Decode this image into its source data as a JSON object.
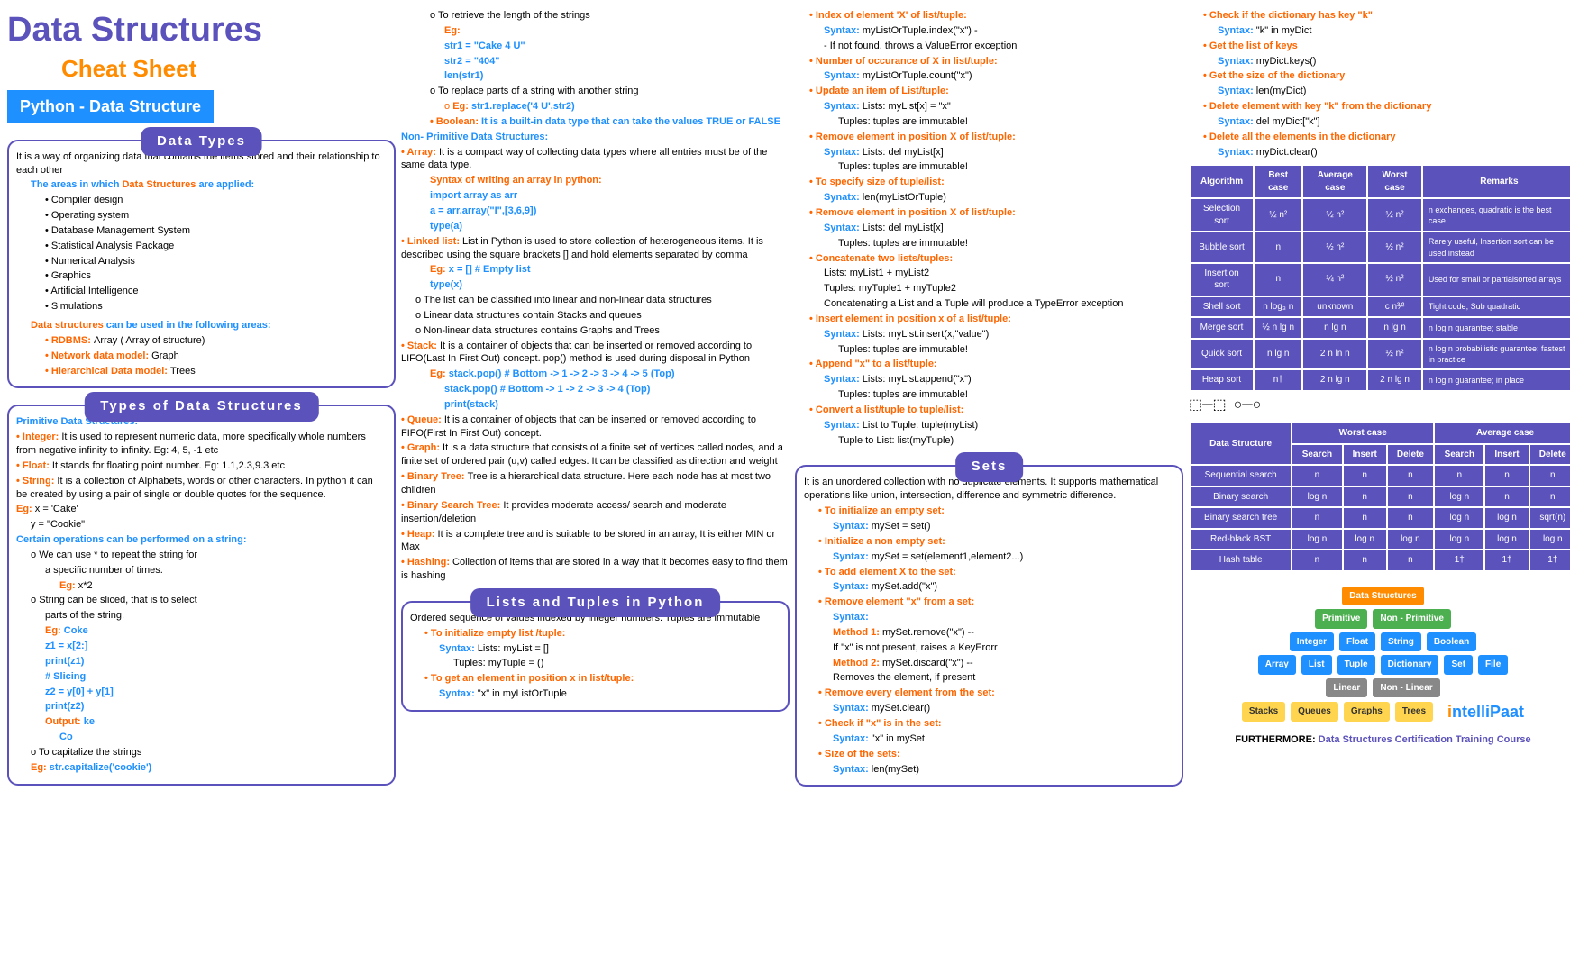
{
  "header": {
    "main_title": "Data Structures",
    "sub_title": "Cheat Sheet",
    "badge": "Python - Data Structure"
  },
  "c1": {
    "dt_title": "Data Types",
    "dt_intro": "It is a way of organizing data that contains the items stored and their relationship to each other",
    "dt_areas_lead": "The areas in which ",
    "dt_areas_bold": "Data Structures",
    "dt_areas_tail": " are applied:",
    "dt_app1": "Compiler design",
    "dt_app2": "Operating system",
    "dt_app3": "Database Management System",
    "dt_app4": "Statistical Analysis Package",
    "dt_app5": "Numerical Analysis",
    "dt_app6": "Graphics",
    "dt_app7": "Artificial Intelligence",
    "dt_app8": "Simulations",
    "dt_used_lead": "Data structures",
    "dt_used_tail": " can be used in the following areas:",
    "dt_m1a": "RDBMS: ",
    "dt_m1b": "Array ( Array of structure)",
    "dt_m2a": "Network data model: ",
    "dt_m2b": "Graph",
    "dt_m3a": "Hierarchical Data model: ",
    "dt_m3b": "Trees",
    "tds_title": "Types of Data Structures",
    "tds_prim_head": "Primitive Data Structures:",
    "tds_int_a": "Integer: ",
    "tds_int_b": "It is used to represent numeric data, more specifically whole numbers from negative infinity to infinity. Eg: 4, 5, -1 etc",
    "tds_flt_a": "Float: ",
    "tds_flt_b": "It stands for floating point number. Eg: 1.1,2.3,9.3 etc",
    "tds_str_a": "String: ",
    "tds_str_b": "It is a collection of Alphabets, words or other characters. In python it can be created by using a pair of single or double quotes for the sequence.",
    "tds_eg1a": "Eg: ",
    "tds_eg1b": "x = 'Cake'",
    "tds_eg2": "y = \"Cookie\"",
    "tds_ops_head": "Certain operations can be performed on a string:",
    "tds_op1a": "We can use * to repeat the string for",
    "tds_op1b": "a specific number of times.",
    "tds_op1_eg_a": "Eg: ",
    "tds_op1_eg_b": "x*2",
    "tds_op2a": "String can be sliced, that is to select",
    "tds_op2b": "parts of the string.",
    "tds_op2_eg": "Eg:",
    "tds_op2_coke": "Coke",
    "tds_op2_l1": "z1 = x[2:]",
    "tds_op2_l2": "print(z1)",
    "tds_op2_l3": "# Slicing",
    "tds_op2_l4": "z2 = y[0] + y[1]",
    "tds_op2_l5": "print(z2)",
    "tds_op2_out_a": "Output: ",
    "tds_op2_out_b": "ke",
    "tds_op2_out_c": "Co",
    "tds_cap_a": "To capitalize the strings",
    "tds_cap_eg_a": "Eg: ",
    "tds_cap_eg_b": "str.capitalize('cookie')"
  },
  "c2": {
    "len_a": "To retrieve the length of the strings",
    "len_eg": "Eg:",
    "len_l1": "str1 = \"Cake 4 U\"",
    "len_l2": "str2 = \"404\"",
    "len_l3": "len(str1)",
    "rep_a": "To replace parts of a string with another string",
    "rep_eg_a": "Eg: ",
    "rep_eg_b": "str1.replace('4 U',str2)",
    "bool_a": "Boolean: ",
    "bool_b": "It is a built-in data type that can take the values TRUE or FALSE",
    "np_head": "Non- Primitive Data Structures:",
    "arr_a": "Array: ",
    "arr_b": "It is a compact way of collecting data types where all entries must be of the same data type.",
    "arr_syn_head": "Syntax of writing an array in python:",
    "arr_l1": "import array as arr",
    "arr_l2": "a = arr.array(\"I\",[3,6,9])",
    "arr_l3": "type(a)",
    "ll_a": "Linked list: ",
    "ll_b": "List in Python is used to store collection of heterogeneous items. It is described using the square brackets [] and hold elements separated by comma",
    "ll_eg_a": "Eg: ",
    "ll_eg_b": "x = [] # Empty list",
    "ll_eg_c": "type(x)",
    "ll_c1": "The list can be classified into linear and non-linear data structures",
    "ll_c2": "Linear data structures contain Stacks and queues",
    "ll_c3": "Non-linear data structures contains Graphs and Trees",
    "stk_a": "Stack: ",
    "stk_b": "It is a container of objects that can be inserted or removed according to LIFO(Last In First Out) concept. pop() method is used during disposal in Python",
    "stk_eg_a": "Eg: ",
    "stk_eg_b": "stack.pop() # Bottom -> 1 -> 2 -> 3 -> 4 -> 5 (Top)",
    "stk_eg_c": "stack.pop() # Bottom -> 1 -> 2 -> 3 -> 4 (Top)",
    "stk_eg_d": "print(stack)",
    "que_a": "Queue: ",
    "que_b": "It is a container of objects that can be inserted or removed according to FIFO(First In First Out) concept.",
    "grp_a": "Graph: ",
    "grp_b": "It is a data structure that consists of a finite set of vertices called nodes, and a finite set of ordered pair (u,v) called edges. It can be classified as direction and weight",
    "bt_a": "Binary Tree: ",
    "bt_b": "Tree is a hierarchical data structure. Here each node has at most two children",
    "bst_a": "Binary Search Tree: ",
    "bst_b": "It provides moderate access/ search and moderate insertion/deletion",
    "hp_a": "Heap: ",
    "hp_b": "It is a complete tree and is suitable to be stored in an array, It is either MIN or Max",
    "hsh_a": "Hashing: ",
    "hsh_b": "Collection of items that are stored in a way that it becomes easy to find them is hashing",
    "lt_title": "Lists and Tuples in Python",
    "lt_intro": "Ordered sequence of values indexed by integer numbers. Tuples are immutable",
    "lt_init_head": "To initialize empty list /tuple:",
    "lt_init_l": "Syntax: ",
    "lt_init_lb": "Lists: myList = []",
    "lt_init_t": "Tuples: myTuple = ()",
    "lt_get_head": "To get an element in position x in list/tuple:",
    "lt_get_a": "Syntax: ",
    "lt_get_b": "\"x\" in myListOrTuple"
  },
  "c3": {
    "idx_head": "Index of element 'X' of list/tuple:",
    "idx_a": "Syntax: ",
    "idx_b": "myListOrTuple.index(\"x\") -",
    "idx_c": "- If not found, throws a ValueError exception",
    "cnt_head": "Number of occurance of X in list/tuple:",
    "cnt_a": "Syntax: ",
    "cnt_b": "myListOrTuple.count(\"x\")",
    "upd_head": "Update an item of List/tuple:",
    "upd_a": "Syntax: ",
    "upd_b": "Lists: myList[x] = \"x\"",
    "upd_c": "Tuples: tuples are immutable!",
    "rem_head": "Remove element in position X of list/tuple:",
    "rem_a": "Syntax: ",
    "rem_b": "Lists: del myList[x]",
    "rem_c": "Tuples: tuples are immutable!",
    "size_head": "To specify size of tuple/list:",
    "size_a": "Synatx: ",
    "size_b": "len(myListOrTuple)",
    "rem2_head": "Remove element in position X of list/tuple:",
    "rem2_a": "Syntax: ",
    "rem2_b": "Lists: del myList[x]",
    "rem2_c": "Tuples: tuples are immutable!",
    "cat_head": "Concatenate two lists/tuples:",
    "cat_l": "Lists: myList1 + myList2",
    "cat_t": "Tuples: myTuple1 + myTuple2",
    "cat_warn": "Concatenating a List and a Tuple will produce a TypeError exception",
    "ins_head": "Insert element in position x of a list/tuple:",
    "ins_a": "Syntax: ",
    "ins_b": "Lists: myList.insert(x,\"value\")",
    "ins_c": "Tuples: tuples are immutable!",
    "app_head": "Append \"x\" to a list/tuple:",
    "app_a": "Syntax: ",
    "app_b": "Lists: myList.append(\"x\")",
    "app_c": "Tuples: tuples are immutable!",
    "cvt_head": "Convert a list/tuple to tuple/list:",
    "cvt_a": "Syntax: ",
    "cvt_b": "List to Tuple: tuple(myList)",
    "cvt_c": "Tuple to List: list(myTuple)",
    "sets_title": "Sets",
    "sets_intro": "It is an unordered collection with no duplicate elements. It supports mathematical operations like union, intersection, difference and symmetric difference.",
    "s_init_head": "To initialize an empty set:",
    "s_init_a": "Syntax: ",
    "s_init_b": "mySet = set()",
    "s_ne_head": "Initialize a non empty set:",
    "s_ne_a": "Syntax: ",
    "s_ne_b": "mySet = set(element1,element2...)",
    "s_add_head": "To add element X to the set:",
    "s_add_a": "Syntax: ",
    "s_add_b": "mySet.add(\"x\")",
    "s_rem_head": "Remove element \"x\" from a set:",
    "s_rem_a": "Syntax:",
    "s_rem_m1a": "Method 1: ",
    "s_rem_m1b": "mySet.remove(\"x\") --",
    "s_rem_m1c": "If \"x\" is not present, raises a KeyErorr",
    "s_rem_m2a": "Method 2: ",
    "s_rem_m2b": "mySet.discard(\"x\") --",
    "s_rem_m2c": "Removes the element, if present",
    "s_clr_head": "Remove every element from the set:",
    "s_clr_a": "Syntax: ",
    "s_clr_b": "mySet.clear()",
    "s_in_head": "Check if \"x\" is in the set:",
    "s_in_a": "Syntax: ",
    "s_in_b": "\"x\" in mySet",
    "s_sz_head": "Size of the sets:",
    "s_sz_a": "Syntax: ",
    "s_sz_b": "len(mySet)"
  },
  "c4": {
    "d1": "Check if the dictionary has key \"k\"",
    "d1a": "Syntax: ",
    "d1b": "\"k\" in myDict",
    "d2": "Get the list of keys",
    "d2a": "Syntax: ",
    "d2b": "myDict.keys()",
    "d3": "Get the size of the dictionary",
    "d3a": "Syntax: ",
    "d3b": "len(myDict)",
    "d4": "Delete element with key \"k\" from the dictionary",
    "d4a": "Syntax: ",
    "d4b": "del myDict[\"k\"]",
    "d5": "Delete all the elements in the dictionary",
    "d5a": "Syntax: ",
    "d5b": "myDict.clear()",
    "tbl1_head": [
      "Algorithm",
      "Best case",
      "Average case",
      "Worst case",
      "Remarks"
    ],
    "tbl1": [
      [
        "Selection sort",
        "½ n²",
        "½ n²",
        "½ n²",
        "n exchanges, quadratic is the best case"
      ],
      [
        "Bubble sort",
        "n",
        "½ n²",
        "½ n²",
        "Rarely useful, Insertion sort can be used instead"
      ],
      [
        "Insertion sort",
        "n",
        "¼ n²",
        "½ n²",
        "Used for small or partialsorted arrays"
      ],
      [
        "Shell sort",
        "n log₃ n",
        "unknown",
        "c n³⁄²",
        "Tight code, Sub quadratic"
      ],
      [
        "Merge sort",
        "½ n lg n",
        "n lg n",
        "n lg n",
        "n log n guarantee; stable"
      ],
      [
        "Quick sort",
        "n lg n",
        "2 n ln n",
        "½ n²",
        "n log n probabilistic guarantee; fastest in practice"
      ],
      [
        "Heap sort",
        "n†",
        "2 n lg n",
        "2 n lg n",
        "n log n guarantee; in place"
      ]
    ],
    "tbl2_head": [
      "Data Structure",
      "Search",
      "Insert",
      "Delete",
      "Search",
      "Insert",
      "Delete"
    ],
    "tbl2_span_head": [
      "Worst case",
      "Average case"
    ],
    "tbl2": [
      [
        "Sequential search",
        "n",
        "n",
        "n",
        "n",
        "n",
        "n"
      ],
      [
        "Binary search",
        "log n",
        "n",
        "n",
        "log n",
        "n",
        "n"
      ],
      [
        "Binary search tree",
        "n",
        "n",
        "n",
        "log n",
        "log n",
        "sqrt(n)"
      ],
      [
        "Red-black BST",
        "log n",
        "log n",
        "log n",
        "log n",
        "log n",
        "log n"
      ],
      [
        "Hash table",
        "n",
        "n",
        "n",
        "1†",
        "1†",
        "1†"
      ]
    ],
    "tree": {
      "root": "Data Structures",
      "prim": "Primitive",
      "nonprim": "Non - Primitive",
      "p1": "Integer",
      "p2": "Float",
      "p3": "String",
      "p4": "Boolean",
      "np1": "Array",
      "np2": "List",
      "np3": "Tuple",
      "np4": "Dictionary",
      "np5": "Set",
      "np6": "File",
      "lin": "Linear",
      "nlin": "Non - Linear",
      "l1": "Stacks",
      "l2": "Queues",
      "l3": "Graphs",
      "l4": "Trees"
    },
    "brand_prefix": "i",
    "brand_rest": "ntelliPaat",
    "footer_a": "FURTHERMORE:",
    "footer_b": "Data Structures Certification Training Course"
  }
}
